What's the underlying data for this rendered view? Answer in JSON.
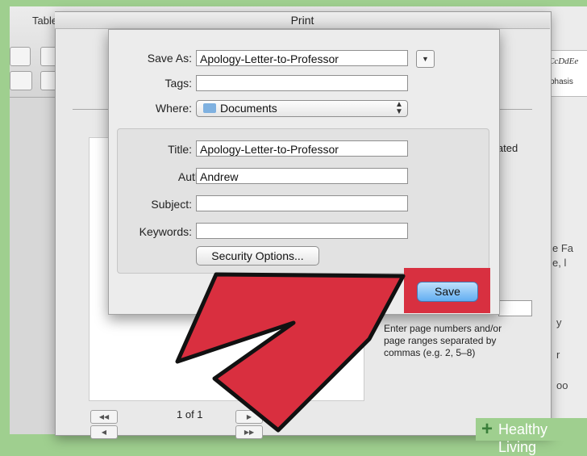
{
  "background": {
    "tab_label": "Table",
    "style_sample": "CcDdEe",
    "style_name": "phasis",
    "fragments": [
      "e Fa",
      "e, l",
      "y",
      "r",
      "oo"
    ]
  },
  "print_dialog": {
    "title": "Print",
    "page_count": "1 of 1",
    "collated_label": "Collated",
    "range_hint": "Enter page numbers and/or page ranges separated by commas (e.g. 2, 5–8)"
  },
  "save_sheet": {
    "save_as_label": "Save As:",
    "save_as_value": "Apology-Letter-to-Professor",
    "tags_label": "Tags:",
    "tags_value": "",
    "where_label": "Where:",
    "where_value": "Documents",
    "title_label": "Title:",
    "title_value": "Apology-Letter-to-Professor",
    "author_label": "Author:",
    "author_value": "Andrew",
    "subject_label": "Subject:",
    "subject_value": "",
    "keywords_label": "Keywords:",
    "keywords_value": "",
    "security_button": "Security Options...",
    "save_button": "Save"
  },
  "watermark": {
    "text": "Healthy Living"
  },
  "colors": {
    "highlight": "#d83040",
    "arrow": "#d92f3f",
    "save_button": "#62aef2"
  }
}
